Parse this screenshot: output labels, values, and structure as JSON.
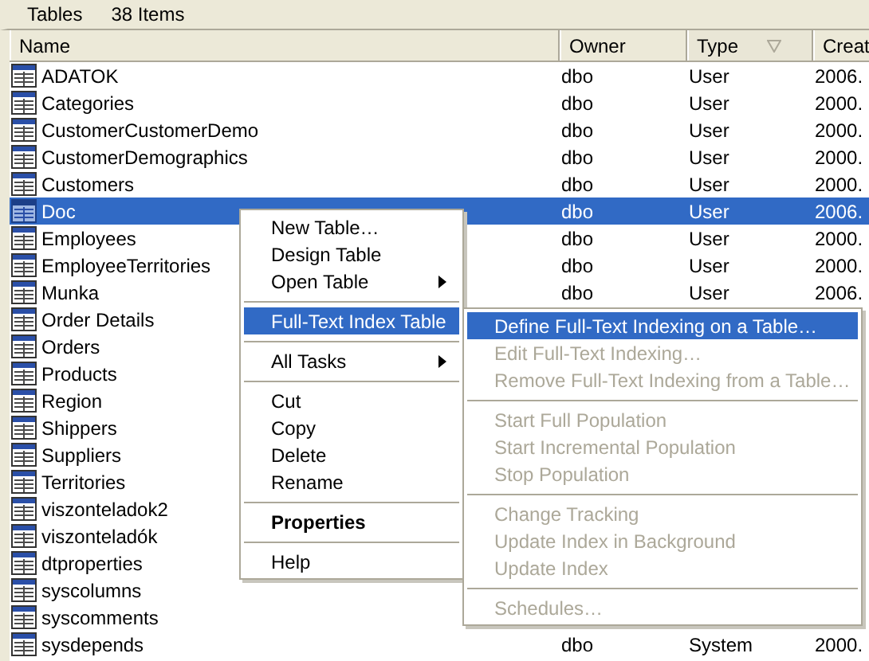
{
  "toolbar": {
    "title": "Tables",
    "count": "38 Items"
  },
  "columns": [
    {
      "label": "Name",
      "sorted": false
    },
    {
      "label": "Owner",
      "sorted": false
    },
    {
      "label": "Type",
      "sorted": true
    },
    {
      "label": "Creat"
    }
  ],
  "rows": [
    {
      "name": "ADATOK",
      "owner": "dbo",
      "type": "User",
      "created": "2006.",
      "selected": false
    },
    {
      "name": "Categories",
      "owner": "dbo",
      "type": "User",
      "created": "2000.",
      "selected": false
    },
    {
      "name": "CustomerCustomerDemo",
      "owner": "dbo",
      "type": "User",
      "created": "2000.",
      "selected": false
    },
    {
      "name": "CustomerDemographics",
      "owner": "dbo",
      "type": "User",
      "created": "2000.",
      "selected": false
    },
    {
      "name": "Customers",
      "owner": "dbo",
      "type": "User",
      "created": "2000.",
      "selected": false
    },
    {
      "name": "Doc",
      "owner": "dbo",
      "type": "User",
      "created": "2006.",
      "selected": true
    },
    {
      "name": "Employees",
      "owner": "dbo",
      "type": "User",
      "created": "2000.",
      "selected": false
    },
    {
      "name": "EmployeeTerritories",
      "owner": "dbo",
      "type": "User",
      "created": "2000.",
      "selected": false
    },
    {
      "name": "Munka",
      "owner": "dbo",
      "type": "User",
      "created": "2006.",
      "selected": false
    },
    {
      "name": "Order Details",
      "selected": false
    },
    {
      "name": "Orders",
      "selected": false
    },
    {
      "name": "Products",
      "selected": false
    },
    {
      "name": "Region",
      "selected": false
    },
    {
      "name": "Shippers",
      "selected": false
    },
    {
      "name": "Suppliers",
      "selected": false
    },
    {
      "name": "Territories",
      "selected": false
    },
    {
      "name": "viszonteladok2",
      "selected": false
    },
    {
      "name": "viszonteladók",
      "selected": false
    },
    {
      "name": "dtproperties",
      "selected": false
    },
    {
      "name": "syscolumns",
      "selected": false
    },
    {
      "name": "syscomments",
      "selected": false
    },
    {
      "name": "sysdepends",
      "owner": "dbo",
      "type": "System",
      "created": "2000.",
      "selected": false
    }
  ],
  "context_menu": [
    {
      "kind": "item",
      "label": "New Table…",
      "submenu": false,
      "selected": false,
      "disabled": false,
      "bold": false
    },
    {
      "kind": "item",
      "label": "Design Table",
      "submenu": false,
      "selected": false,
      "disabled": false,
      "bold": false
    },
    {
      "kind": "item",
      "label": "Open Table",
      "submenu": true,
      "selected": false,
      "disabled": false,
      "bold": false
    },
    {
      "kind": "separator"
    },
    {
      "kind": "item",
      "label": "Full-Text Index Table",
      "submenu": true,
      "selected": true,
      "disabled": false,
      "bold": false
    },
    {
      "kind": "separator"
    },
    {
      "kind": "item",
      "label": "All Tasks",
      "submenu": true,
      "selected": false,
      "disabled": false,
      "bold": false
    },
    {
      "kind": "separator"
    },
    {
      "kind": "item",
      "label": "Cut",
      "submenu": false,
      "selected": false,
      "disabled": false,
      "bold": false
    },
    {
      "kind": "item",
      "label": "Copy",
      "submenu": false,
      "selected": false,
      "disabled": false,
      "bold": false
    },
    {
      "kind": "item",
      "label": "Delete",
      "submenu": false,
      "selected": false,
      "disabled": false,
      "bold": false
    },
    {
      "kind": "item",
      "label": "Rename",
      "submenu": false,
      "selected": false,
      "disabled": false,
      "bold": false
    },
    {
      "kind": "separator"
    },
    {
      "kind": "item",
      "label": "Properties",
      "submenu": false,
      "selected": false,
      "disabled": false,
      "bold": true
    },
    {
      "kind": "separator"
    },
    {
      "kind": "item",
      "label": "Help",
      "submenu": false,
      "selected": false,
      "disabled": false,
      "bold": false
    }
  ],
  "submenu": [
    {
      "kind": "item",
      "label": "Define Full-Text Indexing on a Table…",
      "selected": true,
      "disabled": false
    },
    {
      "kind": "item",
      "label": "Edit Full-Text Indexing…",
      "selected": false,
      "disabled": true
    },
    {
      "kind": "item",
      "label": "Remove Full-Text Indexing from a Table…",
      "selected": false,
      "disabled": true
    },
    {
      "kind": "separator"
    },
    {
      "kind": "item",
      "label": "Start Full Population",
      "selected": false,
      "disabled": true
    },
    {
      "kind": "item",
      "label": "Start Incremental Population",
      "selected": false,
      "disabled": true
    },
    {
      "kind": "item",
      "label": "Stop Population",
      "selected": false,
      "disabled": true
    },
    {
      "kind": "separator"
    },
    {
      "kind": "item",
      "label": "Change Tracking",
      "selected": false,
      "disabled": true
    },
    {
      "kind": "item",
      "label": "Update Index in Background",
      "selected": false,
      "disabled": true
    },
    {
      "kind": "item",
      "label": "Update Index",
      "selected": false,
      "disabled": true
    },
    {
      "kind": "separator"
    },
    {
      "kind": "item",
      "label": "Schedules…",
      "selected": false,
      "disabled": true
    }
  ]
}
